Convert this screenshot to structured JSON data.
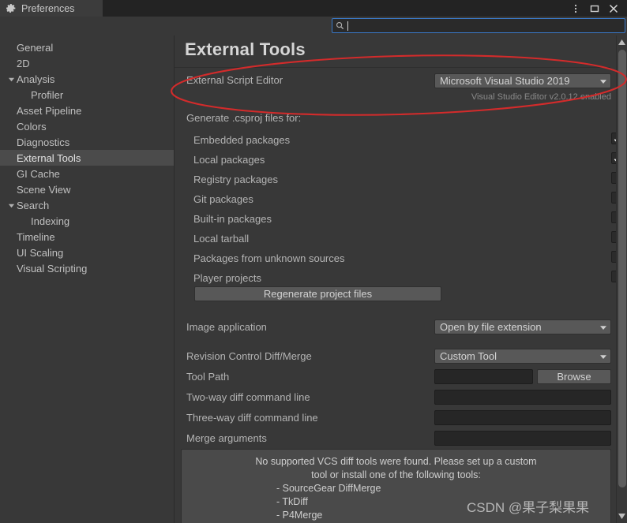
{
  "window": {
    "tab_label": "Preferences",
    "tab_icon": "gear-icon",
    "controls": [
      {
        "name": "more-menu-icon",
        "glyph": "vertical-dots"
      },
      {
        "name": "maximize-icon",
        "glyph": "square"
      },
      {
        "name": "close-icon",
        "glyph": "x"
      }
    ]
  },
  "search": {
    "value": "",
    "placeholder": "",
    "icon": "search-icon"
  },
  "sidebar": {
    "items": [
      {
        "label": "General",
        "indent": 0,
        "arrow": false,
        "selected": false
      },
      {
        "label": "2D",
        "indent": 0,
        "arrow": false,
        "selected": false
      },
      {
        "label": "Analysis",
        "indent": 0,
        "arrow": true,
        "selected": false
      },
      {
        "label": "Profiler",
        "indent": 1,
        "arrow": false,
        "selected": false
      },
      {
        "label": "Asset Pipeline",
        "indent": 0,
        "arrow": false,
        "selected": false
      },
      {
        "label": "Colors",
        "indent": 0,
        "arrow": false,
        "selected": false
      },
      {
        "label": "Diagnostics",
        "indent": 0,
        "arrow": false,
        "selected": false
      },
      {
        "label": "External Tools",
        "indent": 0,
        "arrow": false,
        "selected": true
      },
      {
        "label": "GI Cache",
        "indent": 0,
        "arrow": false,
        "selected": false
      },
      {
        "label": "Scene View",
        "indent": 0,
        "arrow": false,
        "selected": false
      },
      {
        "label": "Search",
        "indent": 0,
        "arrow": true,
        "selected": false
      },
      {
        "label": "Indexing",
        "indent": 1,
        "arrow": false,
        "selected": false
      },
      {
        "label": "Timeline",
        "indent": 0,
        "arrow": false,
        "selected": false
      },
      {
        "label": "UI Scaling",
        "indent": 0,
        "arrow": false,
        "selected": false
      },
      {
        "label": "Visual Scripting",
        "indent": 0,
        "arrow": false,
        "selected": false
      }
    ]
  },
  "main": {
    "title": "External Tools",
    "script_editor": {
      "label": "External Script Editor",
      "value": "Microsoft Visual Studio 2019",
      "note": "Visual Studio Editor v2.0.12 enabled"
    },
    "csproj": {
      "header": "Generate .csproj files for:",
      "options": [
        {
          "label": "Embedded packages",
          "checked": true
        },
        {
          "label": "Local packages",
          "checked": true
        },
        {
          "label": "Registry packages",
          "checked": false
        },
        {
          "label": "Git packages",
          "checked": false
        },
        {
          "label": "Built-in packages",
          "checked": false
        },
        {
          "label": "Local tarball",
          "checked": false
        },
        {
          "label": "Packages from unknown sources",
          "checked": false
        },
        {
          "label": "Player projects",
          "checked": false
        }
      ],
      "regenerate_button": "Regenerate project files"
    },
    "image_application": {
      "label": "Image application",
      "value": "Open by file extension"
    },
    "diff_merge": {
      "label": "Revision Control Diff/Merge",
      "value": "Custom Tool"
    },
    "tool_path": {
      "label": "Tool Path",
      "value": "",
      "browse_button": "Browse"
    },
    "two_way": {
      "label": "Two-way diff command line",
      "value": ""
    },
    "three_way": {
      "label": "Three-way diff command line",
      "value": ""
    },
    "merge_args": {
      "label": "Merge arguments",
      "value": ""
    },
    "help": {
      "line1": "No supported VCS diff tools were found. Please set up a custom",
      "line2": "tool or install one of the following tools:",
      "tools": [
        "- SourceGear DiffMerge",
        "- TkDiff",
        "- P4Merge"
      ]
    }
  },
  "watermark": {
    "text": "CSDN @果子梨果果"
  },
  "annotation": {
    "shape": "ellipse",
    "color": "#d32b2b"
  },
  "colors": {
    "window_bg": "#383838",
    "titlebar_bg": "#232323",
    "tab_bg": "#3c3c3c",
    "selected_row": "#4b4b4b",
    "control_bg": "#585858",
    "field_bg": "#262626",
    "helpbox_bg": "#4a4a4a",
    "focus_border": "#3a79c8",
    "annotation": "#d32b2b"
  }
}
